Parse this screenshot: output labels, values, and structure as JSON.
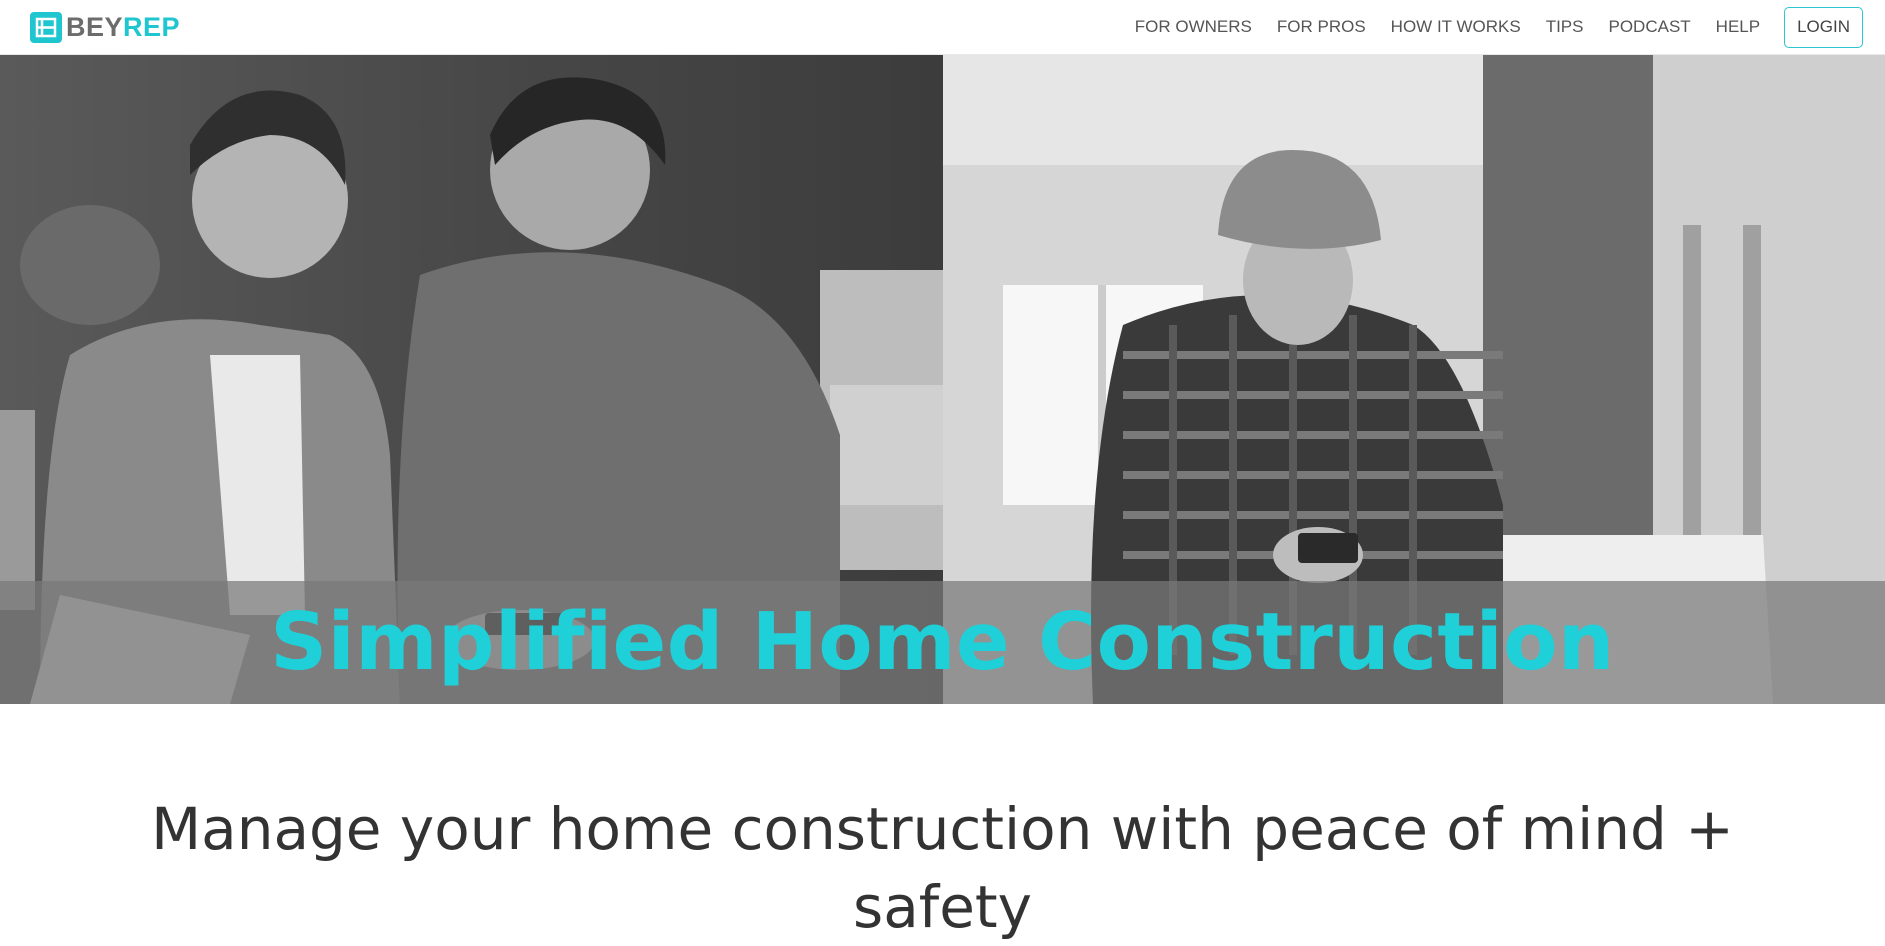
{
  "brand": {
    "logo_part1": "BEY",
    "logo_part2": "REP",
    "accent": "#1fc6cf"
  },
  "nav": {
    "items": [
      {
        "label": "FOR OWNERS"
      },
      {
        "label": "FOR PROS"
      },
      {
        "label": "HOW IT WORKS"
      },
      {
        "label": "TIPS"
      },
      {
        "label": "PODCAST"
      },
      {
        "label": "HELP"
      }
    ],
    "login_label": "LOGIN"
  },
  "hero": {
    "title": "Simplified Home Construction",
    "title_color": "#1fd0d8"
  },
  "intro": {
    "heading": "Manage your home construction with peace of mind +",
    "heading_cont": "safety"
  }
}
